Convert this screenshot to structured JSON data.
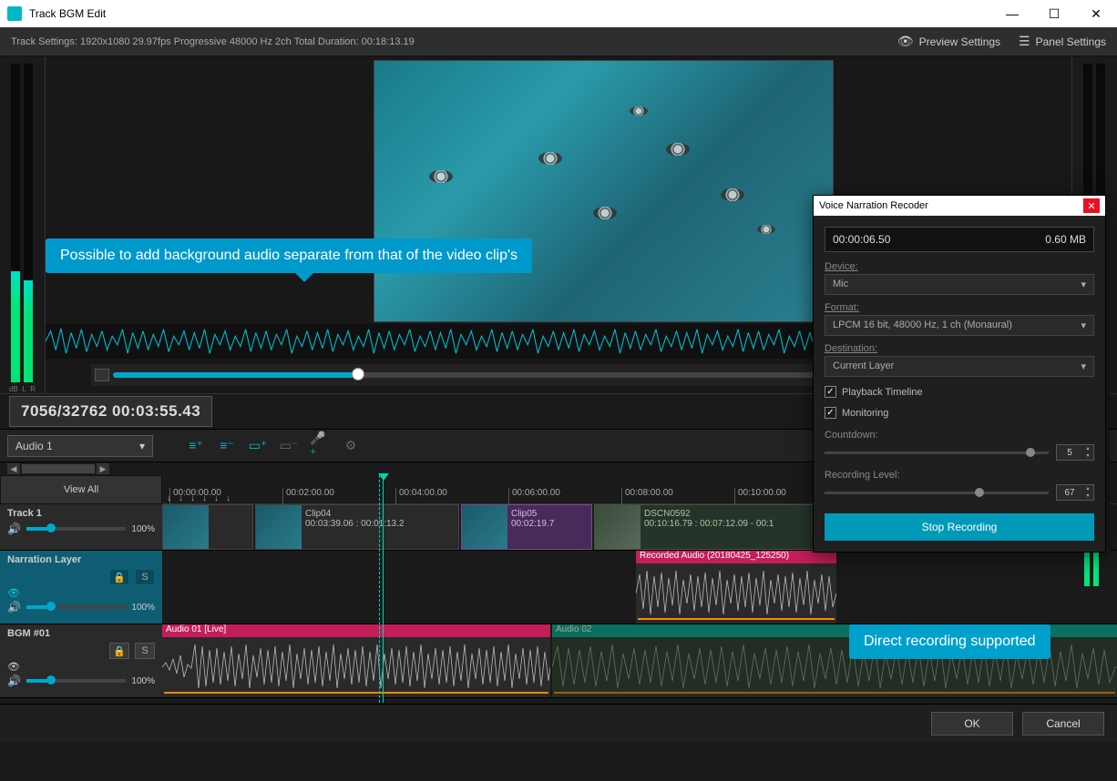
{
  "window": {
    "title": "Track BGM Edit"
  },
  "topbar": {
    "track_settings": "Track Settings:  1920x1080 29.97fps Progressive 48000 Hz 2ch  Total Duration: 00:18:13.19",
    "preview_settings": "Preview Settings",
    "panel_settings": "Panel Settings"
  },
  "callouts": {
    "bg_audio": "Possible to add background audio separate from that of the video clip's",
    "direct_rec": "Direct recording supported"
  },
  "meters": {
    "left_ch1": "L",
    "left_ch2": "R",
    "db": "dB"
  },
  "playbar": {
    "timecode": "7056/32762  00:03:55.43"
  },
  "toolbar": {
    "layer": "Audio 1"
  },
  "ruler": {
    "view_all": "View All",
    "ticks": [
      "00:00:00.00",
      "00:02:00.00",
      "00:04:00.00",
      "00:06:00.00",
      "00:08:00.00",
      "00:10:00.00"
    ]
  },
  "tracks": {
    "track1": {
      "name": "Track 1",
      "vol": "100%",
      "clips": [
        {
          "label": "Clip04",
          "time": "00:03:39.06 : 00:01:13.2"
        },
        {
          "label": "Clip05",
          "time": "00:02:19.7"
        },
        {
          "label": "DSCN0592",
          "time": "00:10:16.79 : 00:07:12.09 - 00:1"
        }
      ]
    },
    "narration": {
      "name": "Narration Layer",
      "vol": "100%",
      "lock": "🔒",
      "solo": "S",
      "rec_audio": "Recorded Audio (20180425_125250)"
    },
    "bgm": {
      "name": "BGM #01",
      "vol": "100%",
      "audio01": "Audio 01  [Live]",
      "audio02": "Audio 02"
    }
  },
  "recorder": {
    "title": "Voice Narration Recoder",
    "time": "00:00:06.50",
    "size": "0.60 MB",
    "device_label": "Device:",
    "device": "Mic",
    "format_label": "Format:",
    "format": "LPCM 16 bit, 48000 Hz, 1 ch (Monaural)",
    "dest_label": "Destination:",
    "dest": "Current Layer",
    "playback": "Playback Timeline",
    "monitoring": "Monitoring",
    "countdown": "Countdown:",
    "countdown_val": "5",
    "rec_level": "Recording Level:",
    "rec_level_val": "67",
    "stop": "Stop Recording"
  },
  "dialog": {
    "ok": "OK",
    "cancel": "Cancel"
  }
}
